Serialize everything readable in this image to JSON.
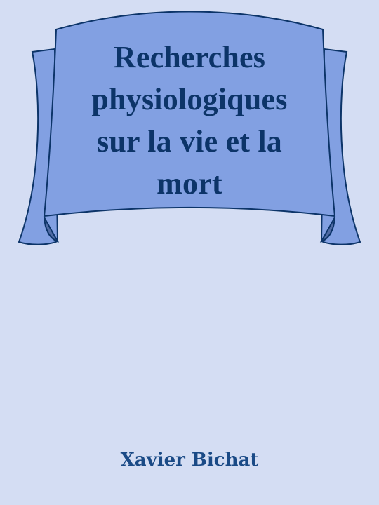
{
  "book": {
    "title_lines": [
      "Recherches",
      "physiologiques",
      "sur la vie et la",
      "mort"
    ],
    "author": "Xavier Bichat"
  },
  "colors": {
    "background": "#d4ddf3",
    "banner_fill": "#82a0e2",
    "banner_shadow": "#4f6aa3",
    "banner_outline": "#0c3468",
    "title_text": "#0c3468",
    "author_text": "#1a4a86"
  },
  "icons": {
    "banner": "ribbon-banner"
  }
}
